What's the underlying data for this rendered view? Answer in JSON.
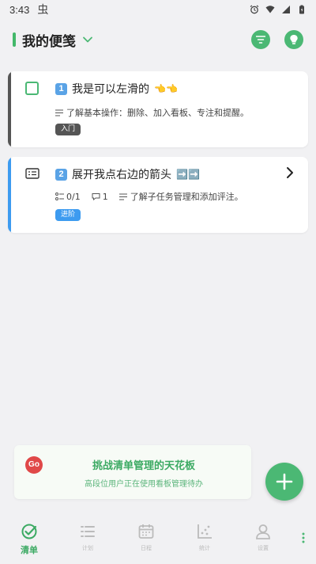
{
  "status_bar": {
    "time": "3:43",
    "bug_glyph": "虫"
  },
  "header": {
    "title": "我的便笺"
  },
  "cards": [
    {
      "number": "1",
      "title": "我是可以左滑的",
      "emoji": "👈👈",
      "description": "了解基本操作：删除、加入看板、专注和提醒。",
      "tag": "入门"
    },
    {
      "number": "2",
      "title": "展开我点右边的箭头",
      "emoji": "➡️➡️",
      "subtasks": "0/1",
      "comments": "1",
      "description": "了解子任务管理和添加评注。",
      "tag": "进阶"
    }
  ],
  "banner": {
    "badge": "Go",
    "title": "挑战清单管理的天花板",
    "subtitle": "高段位用户正在使用看板管理待办"
  },
  "nav": {
    "items": [
      {
        "label": "清单",
        "icon": "check-circle-icon"
      },
      {
        "label": "计划",
        "icon": "list-icon"
      },
      {
        "label": "日程",
        "icon": "calendar-icon"
      },
      {
        "label": "统计",
        "icon": "scatter-chart-icon"
      },
      {
        "label": "设置",
        "icon": "person-icon"
      }
    ]
  },
  "colors": {
    "accent": "#4bb874",
    "blue": "#3d9bf0",
    "red": "#e04848"
  }
}
